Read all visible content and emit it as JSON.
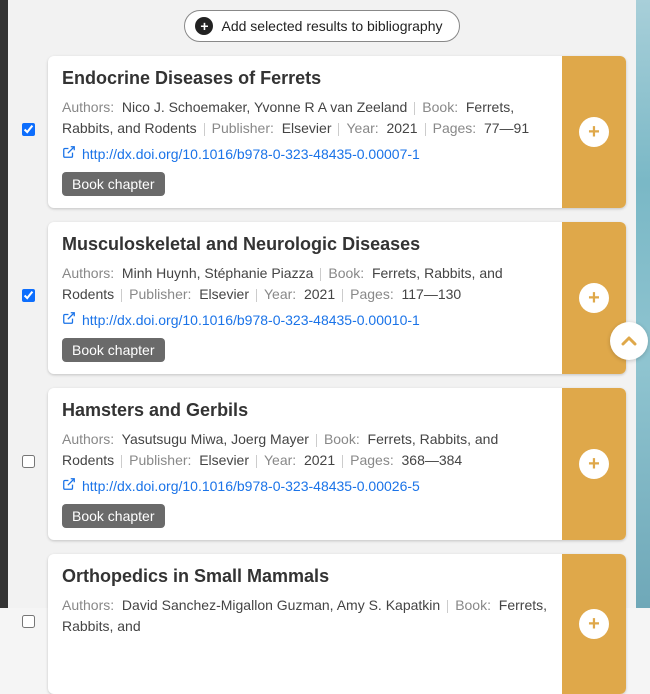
{
  "toolbar": {
    "add_selected_label": "Add selected results to bibliography"
  },
  "labels": {
    "authors": "Authors:",
    "book": "Book:",
    "publisher": "Publisher:",
    "year": "Year:",
    "pages": "Pages:"
  },
  "type_chip": "Book chapter",
  "results": [
    {
      "checked": true,
      "title": "Endocrine Diseases of Ferrets",
      "authors": "Nico J. Schoemaker, Yvonne R A van Zeeland",
      "book": "Ferrets, Rabbits, and Rodents",
      "publisher": "Elsevier",
      "year": "2021",
      "pages": "77—91",
      "doi": "http://dx.doi.org/10.1016/b978-0-323-48435-0.00007-1"
    },
    {
      "checked": true,
      "title": "Musculoskeletal and Neurologic Diseases",
      "authors": "Minh Huynh, Stéphanie Piazza",
      "book": "Ferrets, Rabbits, and Rodents",
      "publisher": "Elsevier",
      "year": "2021",
      "pages": "117—130",
      "doi": "http://dx.doi.org/10.1016/b978-0-323-48435-0.00010-1"
    },
    {
      "checked": false,
      "title": "Hamsters and Gerbils",
      "authors": "Yasutsugu Miwa, Joerg Mayer",
      "book": "Ferrets, Rabbits, and Rodents",
      "publisher": "Elsevier",
      "year": "2021",
      "pages": "368—384",
      "doi": "http://dx.doi.org/10.1016/b978-0-323-48435-0.00026-5"
    },
    {
      "checked": false,
      "title": "Orthopedics in Small Mammals",
      "authors": "David Sanchez-Migallon Guzman, Amy S. Kapatkin",
      "book": "Ferrets, Rabbits, and",
      "publisher": "",
      "year": "",
      "pages": "",
      "doi": ""
    }
  ]
}
